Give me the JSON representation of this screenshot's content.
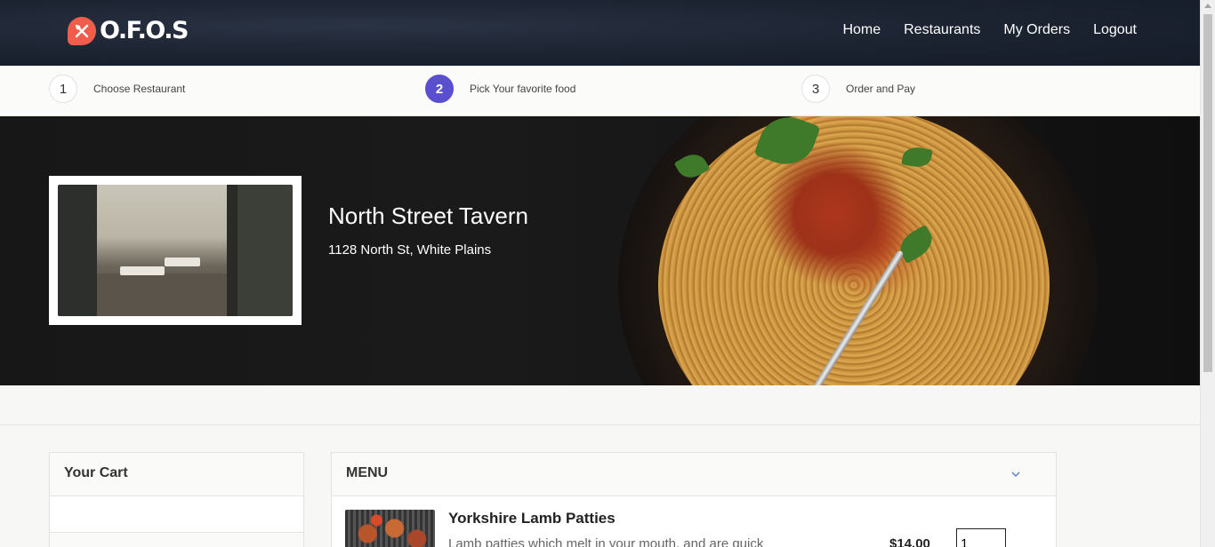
{
  "header": {
    "logo_text": "O.F.O.S",
    "nav": [
      "Home",
      "Restaurants",
      "My Orders",
      "Logout"
    ]
  },
  "steps": [
    {
      "num": "1",
      "label": "Choose Restaurant",
      "active": false
    },
    {
      "num": "2",
      "label": "Pick Your favorite food",
      "active": true
    },
    {
      "num": "3",
      "label": "Order and Pay",
      "active": false
    }
  ],
  "restaurant": {
    "name": "North Street Tavern",
    "address": "1128 North St, White Plains"
  },
  "cart": {
    "title": "Your Cart"
  },
  "menu": {
    "title": "MENU",
    "items": [
      {
        "name": "Yorkshire Lamb Patties",
        "description": "Lamb patties which melt in your mouth, and are quick",
        "price": "$14.00",
        "quantity": "1"
      }
    ]
  },
  "colors": {
    "accent": "#5a4fcf",
    "logo": "#f25c4a",
    "header_bg": "#1b2230"
  },
  "icons": [
    "logo-icon",
    "chevron-down-icon"
  ]
}
